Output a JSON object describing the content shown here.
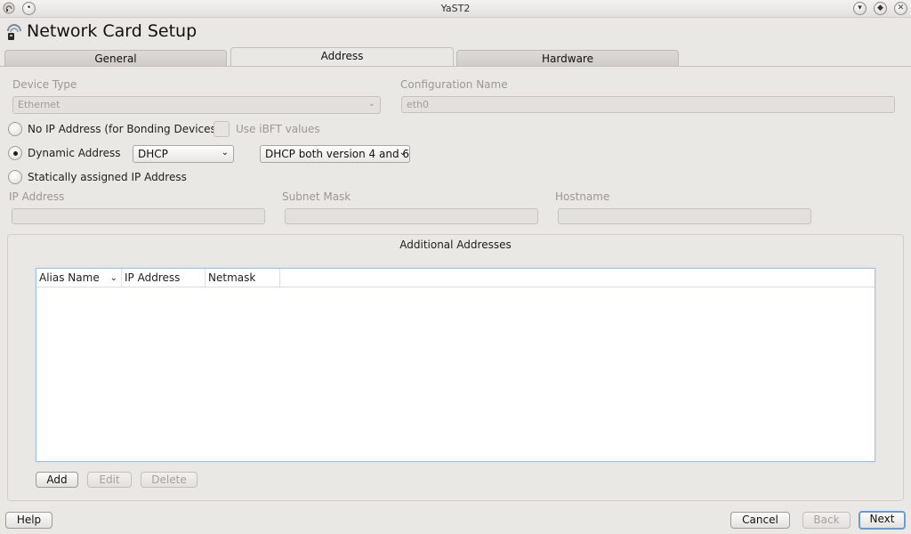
{
  "window": {
    "title": "YaST2"
  },
  "heading": "Network Card Setup",
  "tabs": [
    {
      "label": "General"
    },
    {
      "label": "Address"
    },
    {
      "label": "Hardware"
    }
  ],
  "device_type": {
    "label": "Device Type",
    "value": "Ethernet"
  },
  "configuration_name": {
    "label": "Configuration Name",
    "value": "eth0"
  },
  "options": {
    "no_ip": "No IP Address (for Bonding Devices)",
    "use_ibft": "Use iBFT values",
    "dynamic": "Dynamic Address",
    "dynamic_mode": "DHCP",
    "dhcp_version": "DHCP both version 4 and 6",
    "static": "Statically assigned IP Address",
    "selected": "dynamic"
  },
  "static_fields": {
    "ip_label": "IP Address",
    "subnet_label": "Subnet Mask",
    "hostname_label": "Hostname"
  },
  "additional": {
    "title": "Additional Addresses",
    "columns": [
      "Alias Name",
      "IP Address",
      "Netmask"
    ],
    "rows": [],
    "add": "Add",
    "edit": "Edit",
    "delete": "Delete"
  },
  "footer": {
    "help": "Help",
    "cancel": "Cancel",
    "back": "Back",
    "next": "Next"
  },
  "colors": {
    "window_bg": "#eae8e5",
    "focus_border": "#9fc3e6",
    "default_button": "#6a9bd0"
  },
  "icons": {
    "app_icon": "network-card-icon",
    "title_left": "window-menu-icon",
    "title_buttons": [
      "minimize-icon",
      "maximize-icon",
      "close-icon"
    ]
  }
}
